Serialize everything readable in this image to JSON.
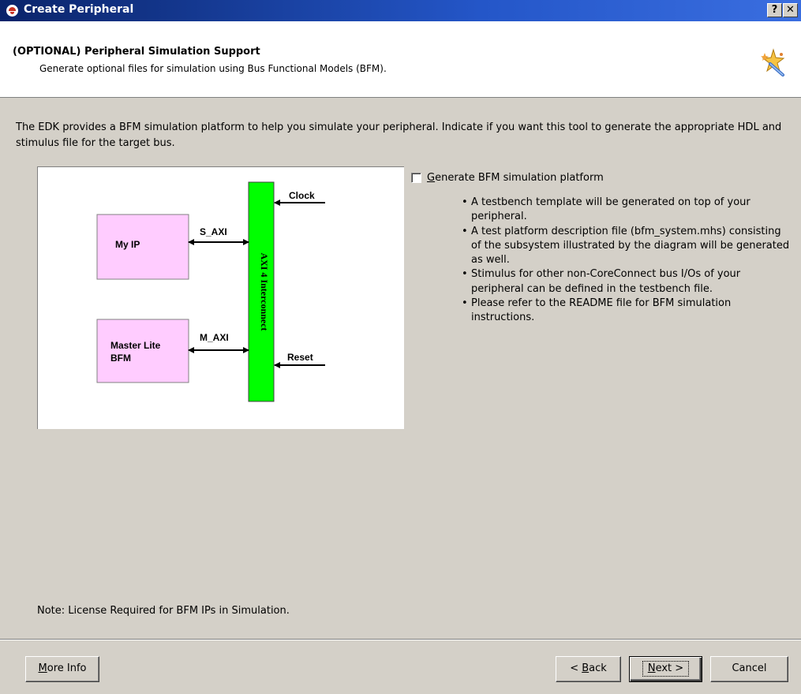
{
  "window": {
    "title": "Create Peripheral",
    "help_glyph": "?",
    "close_glyph": "✕"
  },
  "header": {
    "title": "(OPTIONAL) Peripheral Simulation Support",
    "subtitle": "Generate optional files for simulation using Bus Functional Models (BFM).",
    "icon": "wand-icon"
  },
  "body": {
    "intro": "The EDK provides a BFM simulation platform to help you simulate your peripheral. Indicate if you want this tool to generate the appropriate HDL and stimulus file for the target bus.",
    "diagram": {
      "my_ip": "My IP",
      "master_lite_1": "Master Lite",
      "master_lite_2": "BFM",
      "s_axi": "S_AXI",
      "m_axi": "M_AXI",
      "clock": "Clock",
      "reset": "Reset",
      "interconnect": "AXI 4 Interconnect",
      "colors": {
        "ip_box": "#ffccff",
        "interconnect": "#00ff00"
      }
    },
    "checkbox": {
      "label_accel": "G",
      "label_rest": "enerate BFM simulation platform",
      "checked": false
    },
    "bullets": [
      "A testbench template will be generated on top of your peripheral.",
      "A test platform description file (bfm_system.mhs) consisting of the subsystem illustrated by the diagram will be generated as well.",
      "Stimulus for other non-CoreConnect bus I/Os of your peripheral can be defined in the testbench file.",
      "Please refer to the README file for BFM simulation instructions."
    ],
    "note": "Note: License Required for BFM IPs in Simulation."
  },
  "buttons": {
    "more_info_accel": "M",
    "more_info_rest": "ore Info",
    "back_prefix": "< ",
    "back_accel": "B",
    "back_rest": "ack",
    "next_accel": "N",
    "next_rest": "ext >",
    "cancel": "Cancel"
  }
}
